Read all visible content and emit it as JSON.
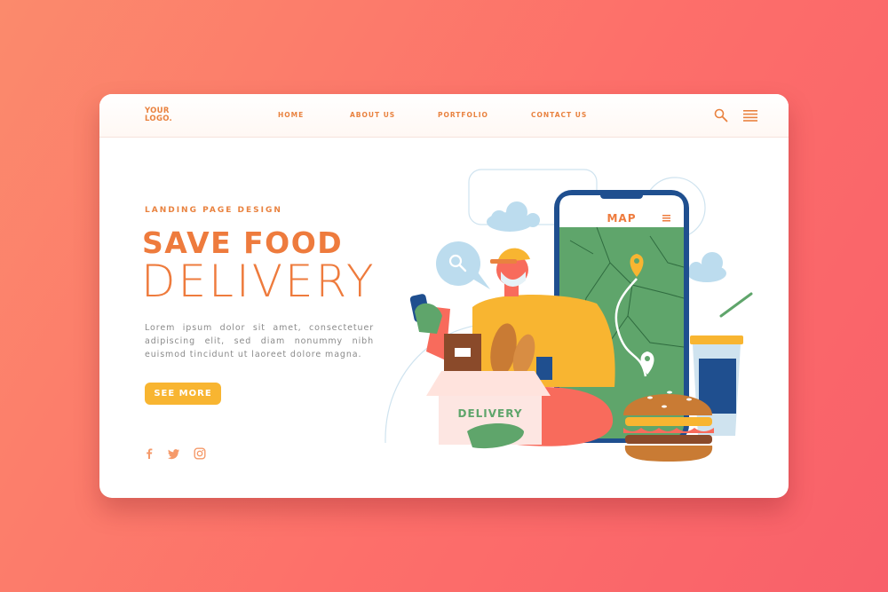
{
  "header": {
    "logo_line1": "YOUR",
    "logo_line2": "LOGO.",
    "nav": [
      "HOME",
      "ABOUT US",
      "PORTFOLIO",
      "CONTACT US"
    ]
  },
  "hero": {
    "eyebrow": "LANDING PAGE DESIGN",
    "title_line1": "SAVE FOOD",
    "title_line2": "DELIVERY",
    "body": "Lorem ipsum dolor sit amet, consectetuer adipiscing elit, sed diam nonummy nibh euismod tincidunt ut laoreet dolore magna.",
    "cta": "SEE MORE"
  },
  "illustration": {
    "phone_header": "MAP",
    "box_label": "DELIVERY"
  },
  "icons": {
    "search": "search-icon",
    "menu": "menu-icon",
    "social": [
      "facebook-icon",
      "twitter-icon",
      "instagram-icon"
    ]
  },
  "colors": {
    "accent": "#ee7b3d",
    "button": "#f8b531",
    "background": "#fd6f6a",
    "map_green": "#5fa56b",
    "phone_frame": "#1f4f8f"
  }
}
